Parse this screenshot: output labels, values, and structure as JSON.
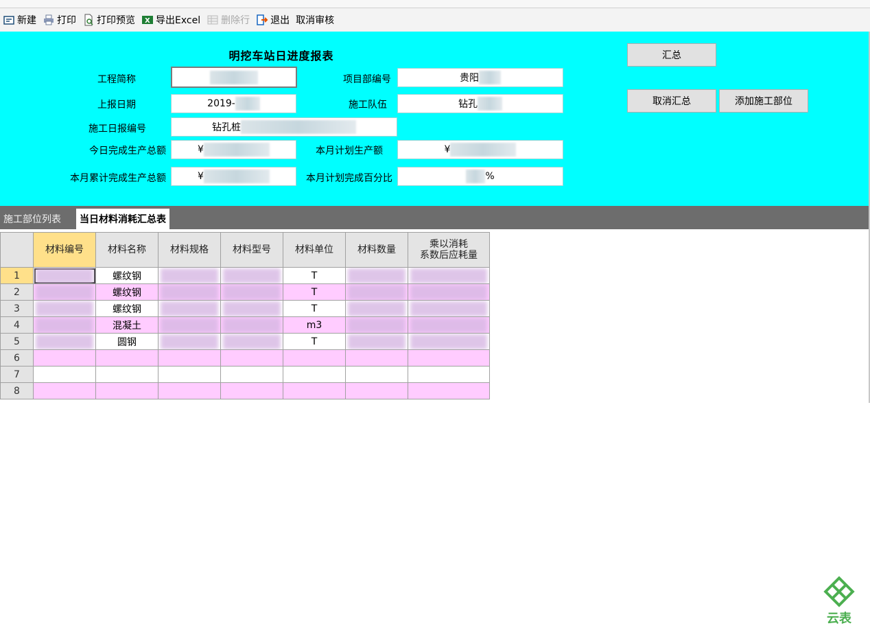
{
  "toolbar": {
    "new": "新建",
    "print": "打印",
    "print_preview": "打印预览",
    "export_excel": "导出Excel",
    "delete_row": "删除行",
    "exit": "退出",
    "cancel_review": "取消审核"
  },
  "form": {
    "title": "明挖车站日进度报表",
    "labels": {
      "project_short_name": "工程简称",
      "project_dept_no": "项目部编号",
      "report_date": "上报日期",
      "construction_team": "施工队伍",
      "daily_report_no": "施工日报编号",
      "today_total": "今日完成生产总额",
      "month_plan": "本月计划生产额",
      "month_cumulative": "本月累计完成生产总额",
      "month_plan_pct": "本月计划完成百分比"
    },
    "values": {
      "project_dept_no": "贵阳",
      "report_date": "2019-",
      "construction_team": "钻孔",
      "daily_report_no": "钻孔桩",
      "today_total": "¥",
      "month_plan": "¥",
      "month_cumulative": "¥",
      "month_plan_pct": "%"
    },
    "buttons": {
      "summary": "汇总",
      "cancel_summary": "取消汇总",
      "add_part": "添加施工部位"
    }
  },
  "tabs": {
    "parts_list": "施工部位列表",
    "material_summary": "当日材料消耗汇总表"
  },
  "grid": {
    "headers": [
      "材料编号",
      "材料名称",
      "材料规格",
      "材料型号",
      "材料单位",
      "材料数量",
      "乘以消耗\n系数后应耗量"
    ],
    "rows": [
      {
        "num": "1",
        "name": "螺纹钢",
        "unit": "T"
      },
      {
        "num": "2",
        "name": "螺纹钢",
        "unit": "T"
      },
      {
        "num": "3",
        "name": "螺纹钢",
        "unit": "T"
      },
      {
        "num": "4",
        "name": "混凝土",
        "unit": "m3"
      },
      {
        "num": "5",
        "name": "圆钢",
        "unit": "T"
      },
      {
        "num": "6",
        "name": "",
        "unit": ""
      },
      {
        "num": "7",
        "name": "",
        "unit": ""
      },
      {
        "num": "8",
        "name": "",
        "unit": ""
      }
    ]
  },
  "logo": {
    "text": "云表",
    "color": "#4caf50"
  },
  "colors": {
    "panel": "#00ffff",
    "row_alt": "#ffccff",
    "selected_header": "#ffe08a"
  }
}
